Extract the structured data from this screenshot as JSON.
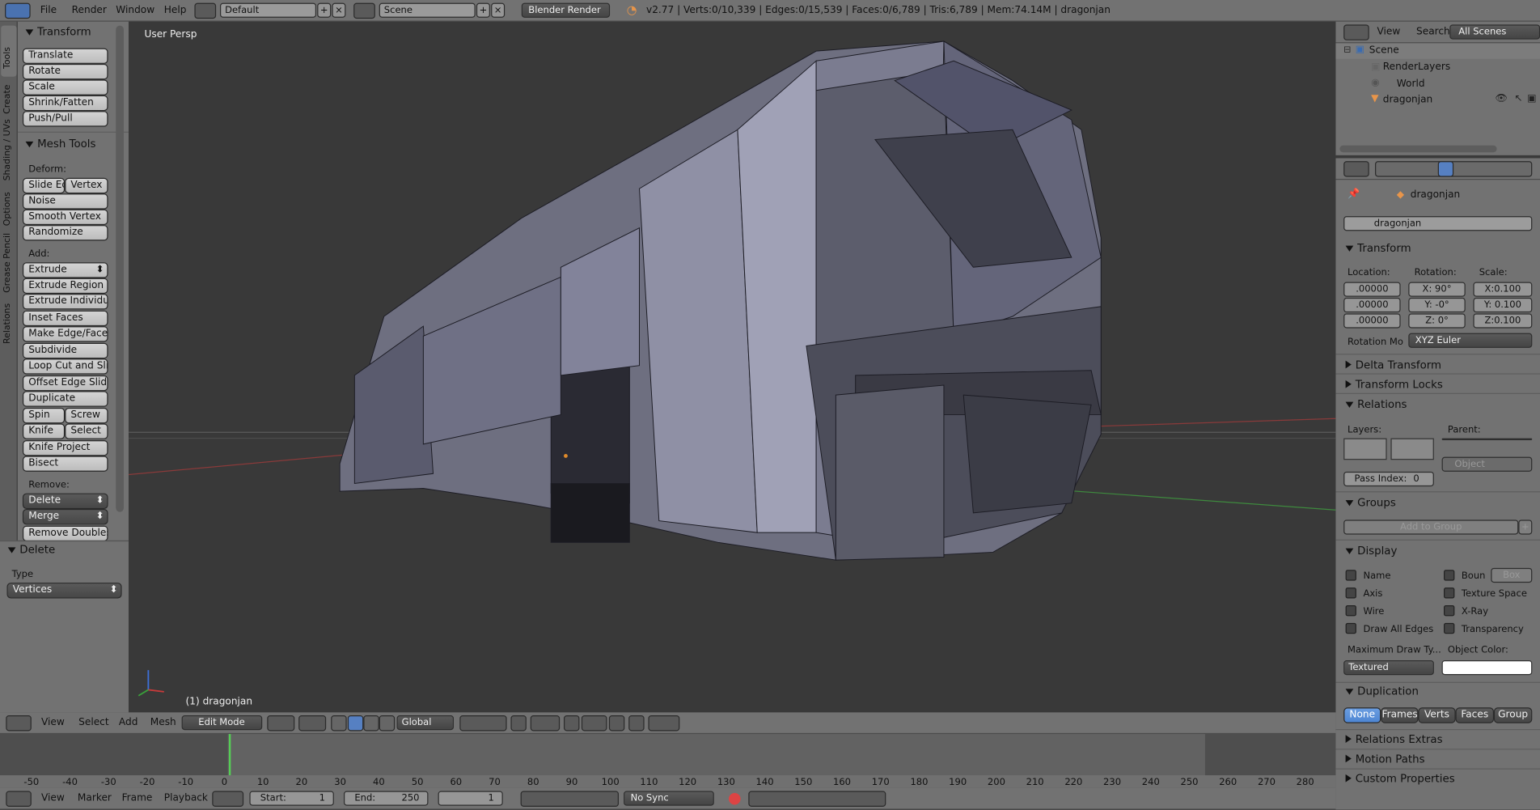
{
  "topbar": {
    "menus": [
      "File",
      "Render",
      "Window",
      "Help"
    ],
    "layout_name": "Default",
    "scene_name": "Scene",
    "engine": "Blender Render",
    "stats": "v2.77 | Verts:0/10,339 | Edges:0/15,539 | Faces:0/6,789 | Tris:6,789 | Mem:74.14M | dragonjan"
  },
  "tool_tabs": [
    "Tools",
    "Create",
    "Shading / UVs",
    "Options",
    "Grease Pencil",
    "Relations"
  ],
  "tools": {
    "transform_title": "Transform",
    "transform_buttons": [
      "Translate",
      "Rotate",
      "Scale",
      "Shrink/Fatten",
      "Push/Pull"
    ],
    "mesh_tools_title": "Mesh Tools",
    "deform_label": "Deform:",
    "slide_edge": "Slide Ed",
    "vertex": "Vertex",
    "deform_buttons": [
      "Noise",
      "Smooth Vertex",
      "Randomize"
    ],
    "add_label": "Add:",
    "extrude": "Extrude",
    "add_buttons": [
      "Extrude Region",
      "Extrude Individual",
      "Inset Faces",
      "Make Edge/Face",
      "Subdivide",
      "Loop Cut and Slide",
      "Offset Edge Slide",
      "Duplicate"
    ],
    "spin": "Spin",
    "screw": "Screw",
    "knife": "Knife",
    "select": "Select",
    "knife_project": "Knife Project",
    "bisect": "Bisect",
    "remove_label": "Remove:",
    "delete": "Delete",
    "merge": "Merge",
    "remove_doubles": "Remove Doubles"
  },
  "operator": {
    "title": "Delete",
    "type_label": "Type",
    "type_value": "Vertices"
  },
  "viewport": {
    "view_label": "User Persp",
    "object_label": "(1) dragonjan",
    "menus": [
      "View",
      "Select",
      "Add",
      "Mesh"
    ],
    "mode": "Edit Mode",
    "orientation": "Global"
  },
  "outliner": {
    "menus": [
      "View",
      "Search"
    ],
    "filter": "All Scenes",
    "items": [
      "Scene",
      "RenderLayers",
      "World",
      "dragonjan"
    ]
  },
  "properties": {
    "breadcrumb_object": "dragonjan",
    "object_name": "dragonjan",
    "transform_title": "Transform",
    "location_label": "Location:",
    "rotation_label": "Rotation:",
    "scale_label": "Scale:",
    "location": [
      ".00000",
      ".00000",
      ".00000"
    ],
    "rotation": [
      "X:   90°",
      "Y:   -0°",
      "Z:    0°"
    ],
    "scale": [
      "X:0.100",
      "Y: 0.100",
      "Z:0.100"
    ],
    "rotation_mode_label": "Rotation Mo",
    "rotation_mode": "XYZ Euler",
    "delta_transform": "Delta Transform",
    "transform_locks": "Transform Locks",
    "relations": "Relations",
    "layers_label": "Layers:",
    "parent_label": "Parent:",
    "parent_type": "Object",
    "pass_index_label": "Pass Index:",
    "pass_index": "0",
    "groups": "Groups",
    "add_to_group": "Add to Group",
    "display": "Display",
    "display_left": [
      "Name",
      "Axis",
      "Wire",
      "Draw All Edges"
    ],
    "display_right": [
      "Boun",
      "Texture Space",
      "X-Ray",
      "Transparency"
    ],
    "bounds_type": "Box",
    "max_draw_label": "Maximum Draw Ty...",
    "object_color_label": "Object Color:",
    "draw_type": "Textured",
    "duplication": "Duplication",
    "dup_options": [
      "None",
      "Frames",
      "Verts",
      "Faces",
      "Group"
    ],
    "relations_extras": "Relations Extras",
    "motion_paths": "Motion Paths",
    "custom_properties": "Custom Properties"
  },
  "timeline": {
    "ticks": [
      "-50",
      "-40",
      "-30",
      "-20",
      "-10",
      "0",
      "10",
      "20",
      "30",
      "40",
      "50",
      "60",
      "70",
      "80",
      "90",
      "100",
      "110",
      "120",
      "130",
      "140",
      "150",
      "160",
      "170",
      "180",
      "190",
      "200",
      "210",
      "220",
      "230",
      "240",
      "250",
      "260",
      "270",
      "280"
    ],
    "menus": [
      "View",
      "Marker",
      "Frame",
      "Playback"
    ],
    "start_label": "Start:",
    "start": "1",
    "end_label": "End:",
    "end": "250",
    "current": "1",
    "sync": "No Sync"
  }
}
